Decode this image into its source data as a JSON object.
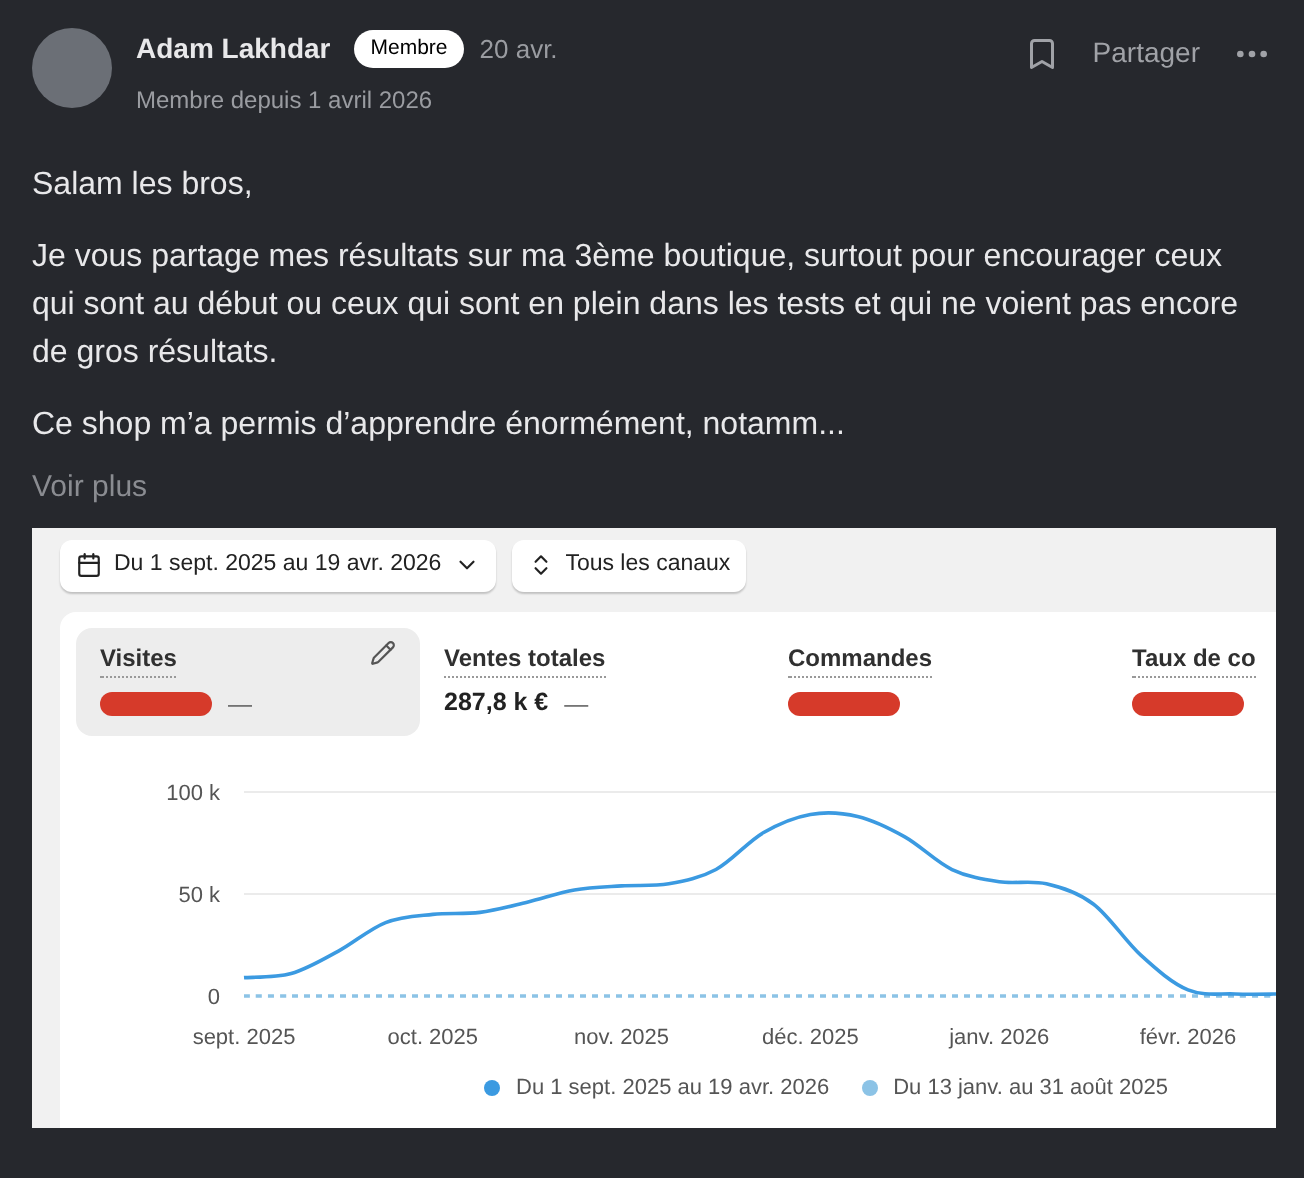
{
  "post": {
    "author": "Adam Lakhdar",
    "badge": "Membre",
    "date": "20 avr.",
    "member_since": "Membre depuis 1 avril 2026",
    "share": "Partager",
    "paragraphs": [
      "Salam les bros,",
      "Je vous partage mes résultats sur ma 3ème boutique, surtout pour encourager ceux qui sont au début ou ceux qui sont en plein dans les tests et qui ne voient pas encore de gros résultats.",
      "Ce shop m’a permis d’apprendre énormément, notamm..."
    ],
    "more": "Voir plus"
  },
  "screenshot": {
    "date_range": "Du 1 sept. 2025 au 19 avr. 2026",
    "channels": "Tous les canaux",
    "metrics": [
      {
        "label": "Visites",
        "selected": true,
        "redacted": true,
        "trend": "—"
      },
      {
        "label": "Ventes totales",
        "selected": false,
        "redacted": false,
        "value": "287,8 k €",
        "trend": "—"
      },
      {
        "label": "Commandes",
        "selected": false,
        "redacted": true
      },
      {
        "label": "Taux de co",
        "selected": false,
        "redacted": true
      }
    ],
    "chart_data": {
      "type": "line",
      "categories": [
        "sept. 2025",
        null,
        null,
        null,
        "oct. 2025",
        null,
        null,
        null,
        "nov. 2025",
        null,
        null,
        null,
        "déc. 2025",
        null,
        null,
        null,
        "janv. 2026",
        null,
        null,
        null,
        "févr. 2026",
        null,
        null
      ],
      "series": [
        {
          "name": "Du 1 sept. 2025 au 19 avr. 2026",
          "color": "#3b9ae1",
          "line_style": "solid",
          "values": [
            9,
            11,
            22,
            36,
            40,
            41,
            46,
            52,
            54,
            55,
            62,
            80,
            89,
            88,
            78,
            62,
            56,
            55,
            45,
            20,
            3,
            1,
            1
          ]
        },
        {
          "name": "Du 13 janv. au 31 août 2025",
          "color": "#8cc3e6",
          "line_style": "dashed",
          "values": [
            0,
            0,
            0,
            0,
            0,
            0,
            0,
            0,
            0,
            0,
            0,
            0,
            0,
            0,
            0,
            0,
            0,
            0,
            0,
            0,
            0,
            0,
            0
          ]
        }
      ],
      "legend": "bottom",
      "ylim": [
        0,
        100
      ],
      "yticks": [
        {
          "value": 0,
          "label": "0"
        },
        {
          "value": 50,
          "label": "50 k"
        },
        {
          "value": 100,
          "label": "100 k"
        }
      ]
    }
  }
}
